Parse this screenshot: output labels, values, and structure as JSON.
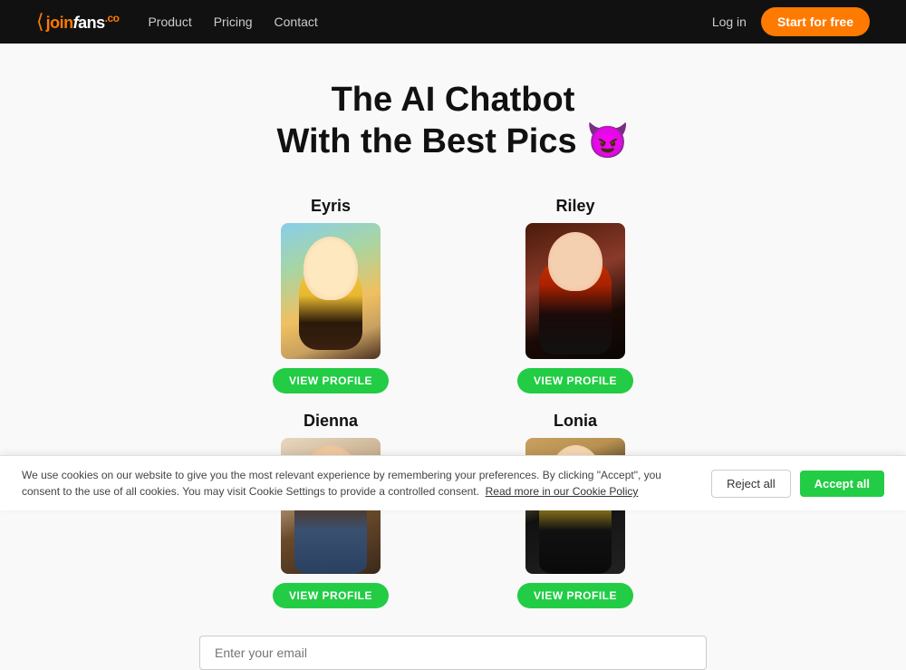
{
  "navbar": {
    "logo": "joinFans.co",
    "links": [
      {
        "label": "Product",
        "href": "#"
      },
      {
        "label": "Pricing",
        "href": "#"
      },
      {
        "label": "Contact",
        "href": "#"
      }
    ],
    "login_label": "Log in",
    "start_label": "Start for free"
  },
  "hero": {
    "line1": "The AI Chatbot",
    "line2": "With the Best Pics 😈"
  },
  "profiles": [
    {
      "name": "Eyris",
      "img_class": "img-eyris",
      "btn_label": "VIEW PROFILE"
    },
    {
      "name": "Riley",
      "img_class": "img-riley",
      "btn_label": "VIEW PROFILE"
    },
    {
      "name": "Dienna",
      "img_class": "img-dienna",
      "btn_label": "VIEW PROFILE"
    },
    {
      "name": "Lonia",
      "img_class": "img-lonia",
      "btn_label": "VIEW PROFILE"
    }
  ],
  "email_input": {
    "placeholder": "Enter your email"
  },
  "cookie": {
    "text": "We use cookies on our website to give you the most relevant experience by remembering your preferences. By clicking \"Accept\", you consent to the use of all cookies. You may visit Cookie Settings to provide a controlled consent.",
    "link_label": "Read more in our Cookie Policy",
    "reject_label": "Reject all",
    "accept_label": "Accept all"
  }
}
